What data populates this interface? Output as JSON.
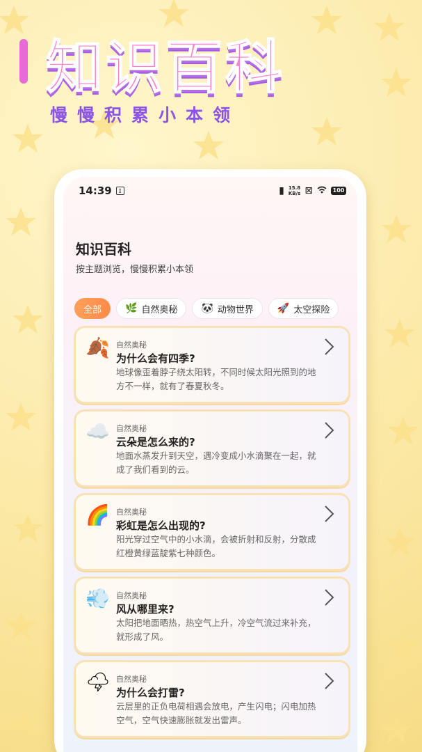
{
  "hero": {
    "title": "知识百科",
    "subtitle": "慢慢积累小本领"
  },
  "status_bar": {
    "time": "14:39",
    "net_speed_top": "15.8",
    "net_speed_bottom": "KB/s",
    "battery": "100"
  },
  "page": {
    "title": "知识百科",
    "subtitle": "按主题浏览，慢慢积累小本领"
  },
  "tabs": [
    {
      "label": "全部",
      "icon": "",
      "active": true
    },
    {
      "label": "自然奥秘",
      "icon": "🌿"
    },
    {
      "label": "动物世界",
      "icon": "🐼"
    },
    {
      "label": "太空探险",
      "icon": "🚀"
    }
  ],
  "cards": [
    {
      "icon": "🍂",
      "category": "自然奥秘",
      "title": "为什么会有四季?",
      "desc": "地球像歪着脖子绕太阳转，不同时候太阳光照到的地方不一样，就有了春夏秋冬。"
    },
    {
      "icon": "☁️",
      "category": "自然奥秘",
      "title": "云朵是怎么来的?",
      "desc": "地面水蒸发升到天空，遇冷变成小水滴聚在一起，就成了我们看到的云。"
    },
    {
      "icon": "🌈",
      "category": "自然奥秘",
      "title": "彩虹是怎么出现的?",
      "desc": "阳光穿过空气中的小水滴，会被折射和反射，分散成红橙黄绿蓝靛紫七种颜色。"
    },
    {
      "icon": "💨",
      "category": "自然奥秘",
      "title": "风从哪里来?",
      "desc": "太阳把地面晒热，热空气上升，冷空气流过来补充，就形成了风。"
    },
    {
      "icon": "🌩",
      "category": "自然奥秘",
      "title": "为什么会打雷?",
      "desc": "云层里的正负电荷相遇会放电，产生闪电；闪电加热空气，空气快速膨胀就发出雷声。"
    }
  ],
  "colors": {
    "accent": "#ff8a48",
    "hero_pink": "#ff82cf",
    "hero_purple": "#8b54e4",
    "card_border": "#f8e1b5"
  }
}
